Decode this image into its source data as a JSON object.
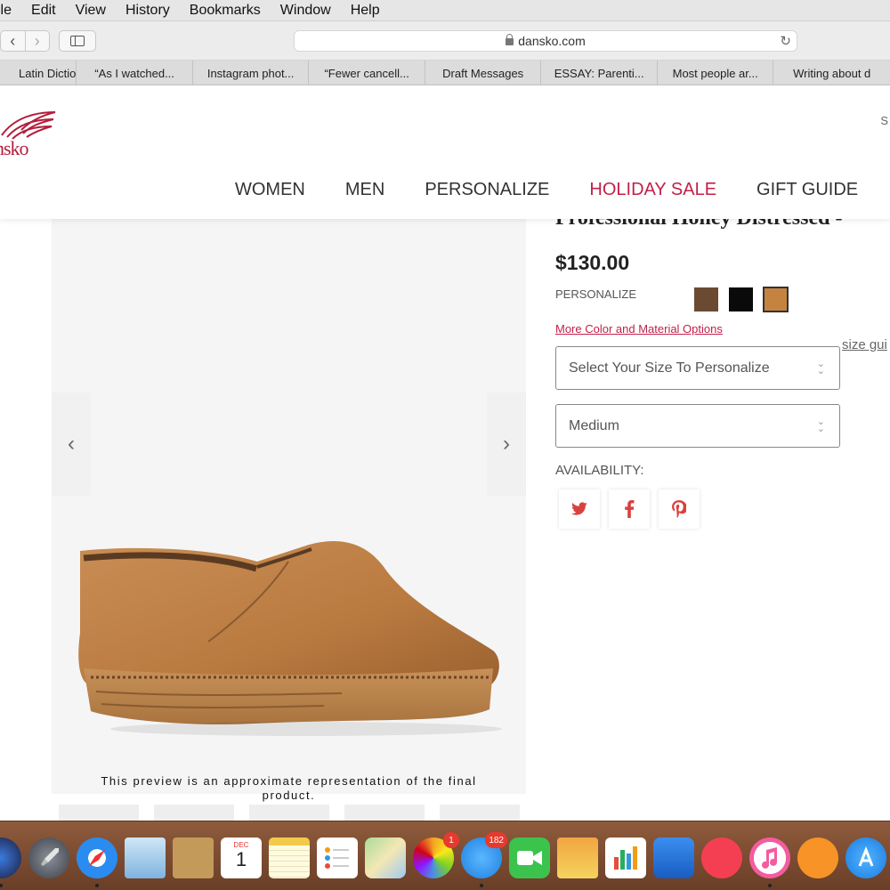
{
  "menubar": {
    "items": [
      "ile",
      "Edit",
      "View",
      "History",
      "Bookmarks",
      "Window",
      "Help"
    ]
  },
  "toolbar": {
    "url": "dansko.com"
  },
  "tabs": [
    "Latin Dictio",
    "“As I watched...",
    "Instagram phot...",
    "“Fewer cancell...",
    "Draft Messages",
    "ESSAY: Parenti...",
    "Most people ar...",
    "Writing about d"
  ],
  "site": {
    "logo_text": "nsko",
    "top_right_letter": "S",
    "nav": [
      "WOMEN",
      "MEN",
      "PERSONALIZE",
      "HOLIDAY SALE",
      "GIFT GUIDE"
    ],
    "nav_sale_color": "#c2204a"
  },
  "gallery": {
    "disclaimer": "This preview is an approximate representation of the final product."
  },
  "product": {
    "title_partial": "Professional Honey Distressed -",
    "price": "$130.00",
    "personalize_label": "PERSONALIZE",
    "swatches": [
      {
        "color": "#6b4a32",
        "selected": false
      },
      {
        "color": "#0a0a0a",
        "selected": false
      },
      {
        "color": "#c4843f",
        "selected": true
      }
    ],
    "more_colors_link": "More Color and Material Options",
    "size_guide": "size gui",
    "size_select": "Select Your Size To Personalize",
    "width_select": "Medium",
    "availability_label": "AVAILABILITY:"
  },
  "dock": {
    "calendar_month": "DEC",
    "calendar_day": "1",
    "photos_badge": "1",
    "messages_badge": "182"
  }
}
